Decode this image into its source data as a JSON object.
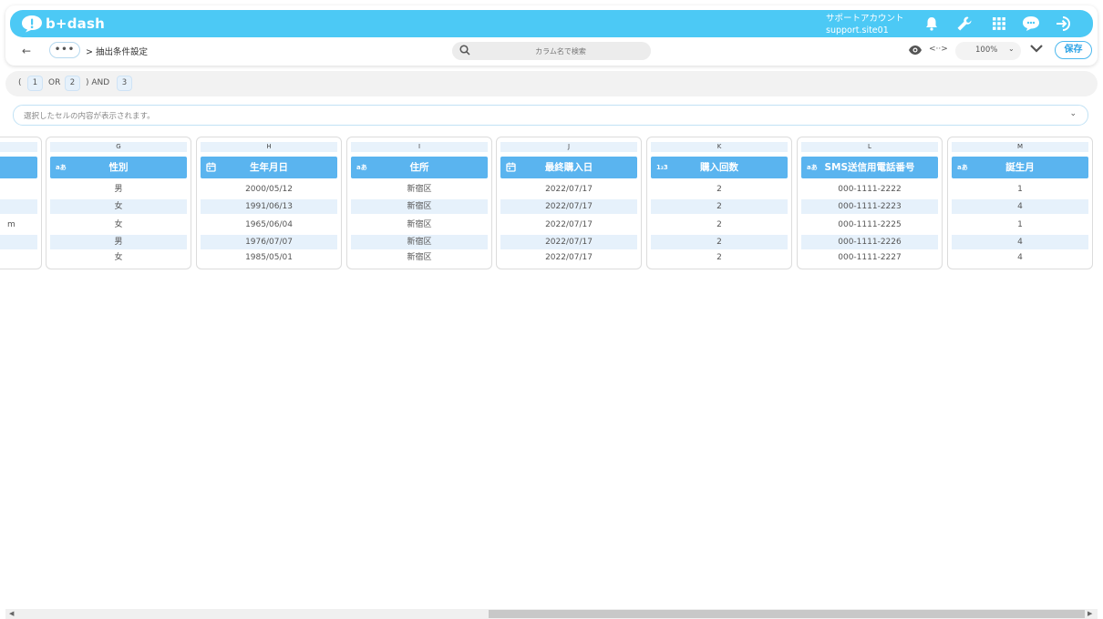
{
  "header": {
    "logo_text": "b+dash",
    "account_name": "サポートアカウント",
    "account_id": "support.site01",
    "icons": [
      "bell-icon",
      "wrench-icon",
      "apps-grid-icon",
      "chat-bubble-icon",
      "logout-icon"
    ]
  },
  "subbar": {
    "back_label": "←",
    "more_label": "•••",
    "breadcrumb": "> 抽出条件設定",
    "search_placeholder": "カラム名で検索",
    "zoom_value": "100%",
    "save_label": "保存"
  },
  "conditions": {
    "open_paren": "(",
    "chip1": "1",
    "op1": "OR",
    "chip2": "2",
    "close_and": ") AND",
    "chip3": "3"
  },
  "cell_bar": {
    "placeholder": "選択したセルの内容が表示されます。"
  },
  "columns": [
    {
      "letter": "",
      "header": "",
      "type": "",
      "cells": [
        "",
        "",
        "m",
        "",
        ""
      ]
    },
    {
      "letter": "G",
      "header": "性別",
      "type": "aあ",
      "cells": [
        "男",
        "女",
        "女",
        "男",
        "女"
      ]
    },
    {
      "letter": "H",
      "header": "生年月日",
      "type": "calendar",
      "cells": [
        "2000/05/12",
        "1991/06/13",
        "1965/06/04",
        "1976/07/07",
        "1985/05/01"
      ]
    },
    {
      "letter": "I",
      "header": "住所",
      "type": "aあ",
      "cells": [
        "新宿区",
        "新宿区",
        "新宿区",
        "新宿区",
        "新宿区"
      ]
    },
    {
      "letter": "J",
      "header": "最終購入日",
      "type": "calendar",
      "cells": [
        "2022/07/17",
        "2022/07/17",
        "2022/07/17",
        "2022/07/17",
        "2022/07/17"
      ]
    },
    {
      "letter": "K",
      "header": "購入回数",
      "type": "123",
      "cells": [
        "2",
        "2",
        "2",
        "2",
        "2"
      ]
    },
    {
      "letter": "L",
      "header": "SMS送信用電話番号",
      "type": "aあ",
      "cells": [
        "000-1111-2222",
        "000-1111-2223",
        "000-1111-2225",
        "000-1111-2226",
        "000-1111-2227"
      ]
    },
    {
      "letter": "M",
      "header": "誕生月",
      "type": "aあ",
      "cells": [
        "1",
        "4",
        "1",
        "4",
        "4"
      ]
    }
  ],
  "colors": {
    "brand": "#4cc9f5",
    "header_cell": "#5ab4ef",
    "alt_row": "#e6f1fb"
  }
}
